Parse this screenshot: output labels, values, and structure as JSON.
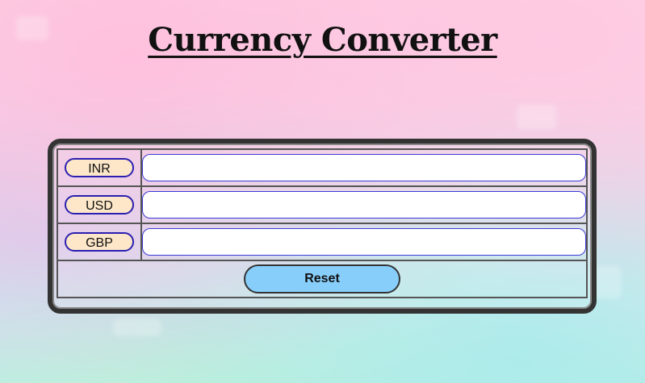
{
  "page": {
    "title": "Currency Converter"
  },
  "converter": {
    "rows": [
      {
        "code": "INR",
        "value": ""
      },
      {
        "code": "USD",
        "value": ""
      },
      {
        "code": "GBP",
        "value": ""
      }
    ],
    "reset_label": "Reset"
  },
  "colors": {
    "badge_fill": "#fde7c8",
    "badge_border": "#2a1fb0",
    "input_border": "#3b3bd6",
    "reset_fill": "#87cefa",
    "panel_border": "#333333"
  }
}
